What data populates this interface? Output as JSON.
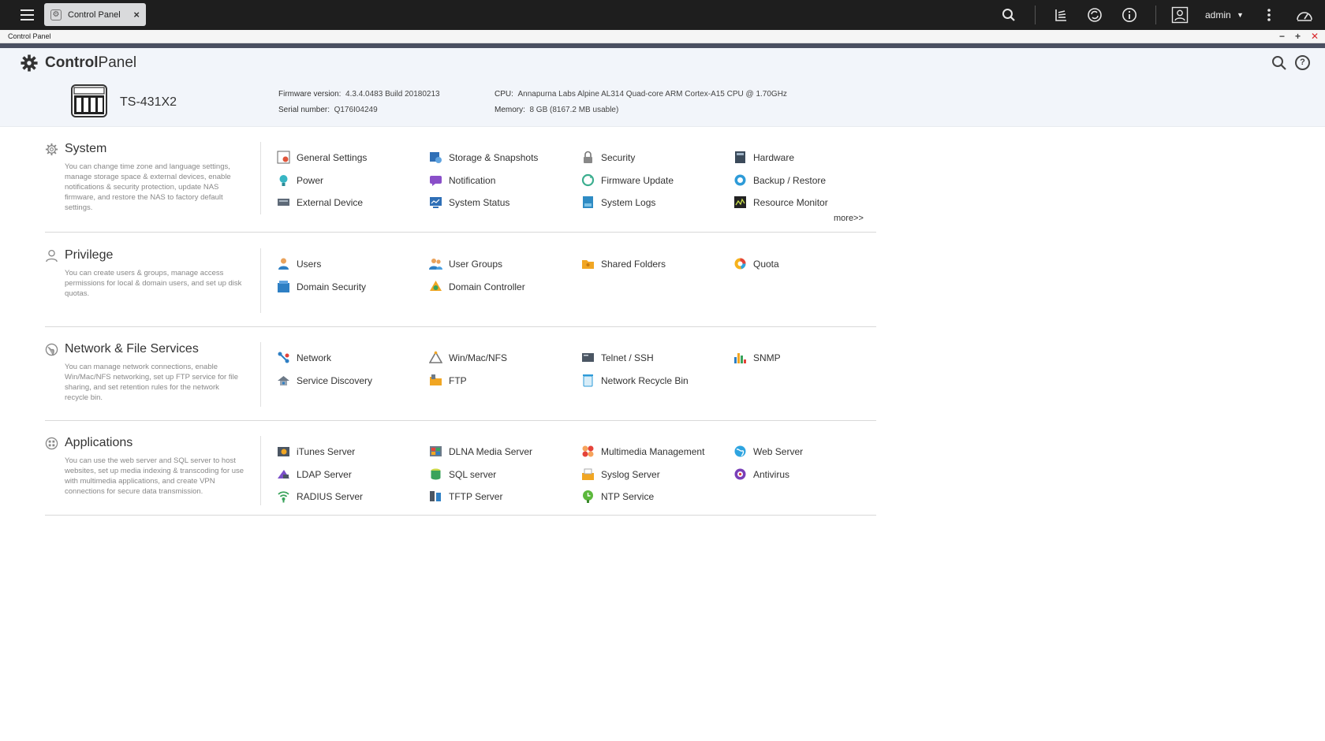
{
  "topbar": {
    "app_tab_label": "Control Panel",
    "user_name": "admin"
  },
  "window": {
    "title": "Control Panel"
  },
  "header": {
    "title_bold": "Control",
    "title_rest": "Panel",
    "model": "TS-431X2",
    "firmware_label": "Firmware version:",
    "firmware_value": "4.3.4.0483 Build 20180213",
    "serial_label": "Serial number:",
    "serial_value": "Q176I04249",
    "cpu_label": "CPU:",
    "cpu_value": "Annapurna Labs Alpine AL314 Quad-core ARM Cortex-A15 CPU @ 1.70GHz",
    "memory_label": "Memory:",
    "memory_value": "8 GB (8167.2 MB usable)"
  },
  "sections": {
    "system": {
      "title": "System",
      "desc": "You can change time zone and language settings, manage storage space & external devices, enable notifications & security protection, update NAS firmware, and restore the NAS to factory default settings.",
      "items": [
        "General Settings",
        "Storage & Snapshots",
        "Security",
        "Hardware",
        "Power",
        "Notification",
        "Firmware Update",
        "Backup / Restore",
        "External Device",
        "System Status",
        "System Logs",
        "Resource Monitor"
      ],
      "more": "more>>"
    },
    "privilege": {
      "title": "Privilege",
      "desc": "You can create users & groups, manage access permissions for local & domain users, and set up disk quotas.",
      "items": [
        "Users",
        "User Groups",
        "Shared Folders",
        "Quota",
        "Domain Security",
        "Domain Controller"
      ]
    },
    "network": {
      "title": "Network & File Services",
      "desc": "You can manage network connections, enable Win/Mac/NFS networking, set up FTP service for file sharing, and set retention rules for the network recycle bin.",
      "items": [
        "Network",
        "Win/Mac/NFS",
        "Telnet / SSH",
        "SNMP",
        "Service Discovery",
        "FTP",
        "Network Recycle Bin"
      ]
    },
    "applications": {
      "title": "Applications",
      "desc": "You can use the web server and SQL server to host websites, set up media indexing & transcoding for use with multimedia applications, and create VPN connections for secure data transmission.",
      "items": [
        "iTunes Server",
        "DLNA Media Server",
        "Multimedia Management",
        "Web Server",
        "LDAP Server",
        "SQL server",
        "Syslog Server",
        "Antivirus",
        "RADIUS Server",
        "TFTP Server",
        "NTP Service"
      ]
    }
  },
  "colors": {
    "topbar": "#1e1e1e",
    "header_bg": "#f2f5fa",
    "accent_strip": "#4a5061",
    "close_red": "#d9262b"
  }
}
